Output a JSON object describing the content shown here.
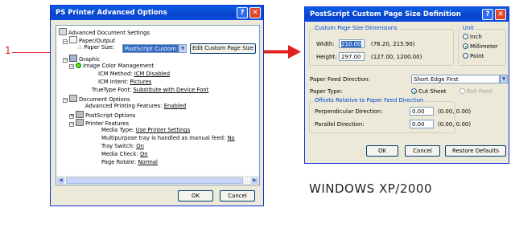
{
  "callout_number": "1",
  "os_caption": "WINDOWS XP/2000",
  "left_window": {
    "title": "PS Printer Advanced Options",
    "help_glyph": "?",
    "close_glyph": "✕",
    "tree": {
      "root": "Advanced Document Settings",
      "paper_output": "Paper/Output",
      "paper_size_label": "Paper Size:",
      "paper_size_value": "PostScript Custom",
      "edit_button": "Edit Custom Page Size",
      "graphic": "Graphic",
      "icm": "Image Color Management",
      "icm_method_label": "ICM Method:",
      "icm_method_value": "ICM Disabled",
      "icm_intent_label": "ICM Intent:",
      "icm_intent_value": "Pictures",
      "truetype_label": "TrueType Font:",
      "truetype_value": "Substitute with Device Font",
      "doc_options": "Document Options",
      "adv_print_label": "Advanced Printing Features:",
      "adv_print_value": "Enabled",
      "ps_options": "PostScript Options",
      "printer_features": "Printer Features",
      "media_type_label": "Media Type:",
      "media_type_value": "Use Printer Settings",
      "multipurpose_label": "Multipurpose tray is handled as manual feed:",
      "multipurpose_value": "No",
      "tray_switch_label": "Tray Switch:",
      "tray_switch_value": "On",
      "media_check_label": "Media Check:",
      "media_check_value": "On",
      "page_rotate_label": "Page Rotate:",
      "page_rotate_value": "Normal"
    },
    "ok": "OK",
    "cancel": "Cancel"
  },
  "right_window": {
    "title": "PostScript Custom Page Size Definition",
    "help_glyph": "?",
    "close_glyph": "✕",
    "dims_group": "Custom Page Size Dimensions",
    "width_label": "Width:",
    "width_value": "210.00",
    "width_range": "(76.20, 215.90)",
    "height_label": "Height:",
    "height_value": "297.00",
    "height_range": "(127.00, 1200.00)",
    "unit_group": "Unit",
    "unit_inch": "Inch",
    "unit_mm": "Millimeter",
    "unit_point": "Point",
    "feed_dir_label": "Paper Feed Direction:",
    "feed_dir_value": "Short Edge First",
    "paper_type_label": "Paper Type:",
    "cut_sheet": "Cut Sheet",
    "roll_feed": "Roll Feed",
    "offsets_group": "Offsets Relative to Paper Feed Direction",
    "perp_label": "Perpendicular Direction:",
    "perp_value": "0.00",
    "perp_range": "(0.00, 0.00)",
    "parallel_label": "Parallel Direction:",
    "parallel_value": "0.00",
    "parallel_range": "(0.00, 0.00)",
    "ok": "OK",
    "cancel": "Cancel",
    "restore": "Restore Defaults"
  }
}
